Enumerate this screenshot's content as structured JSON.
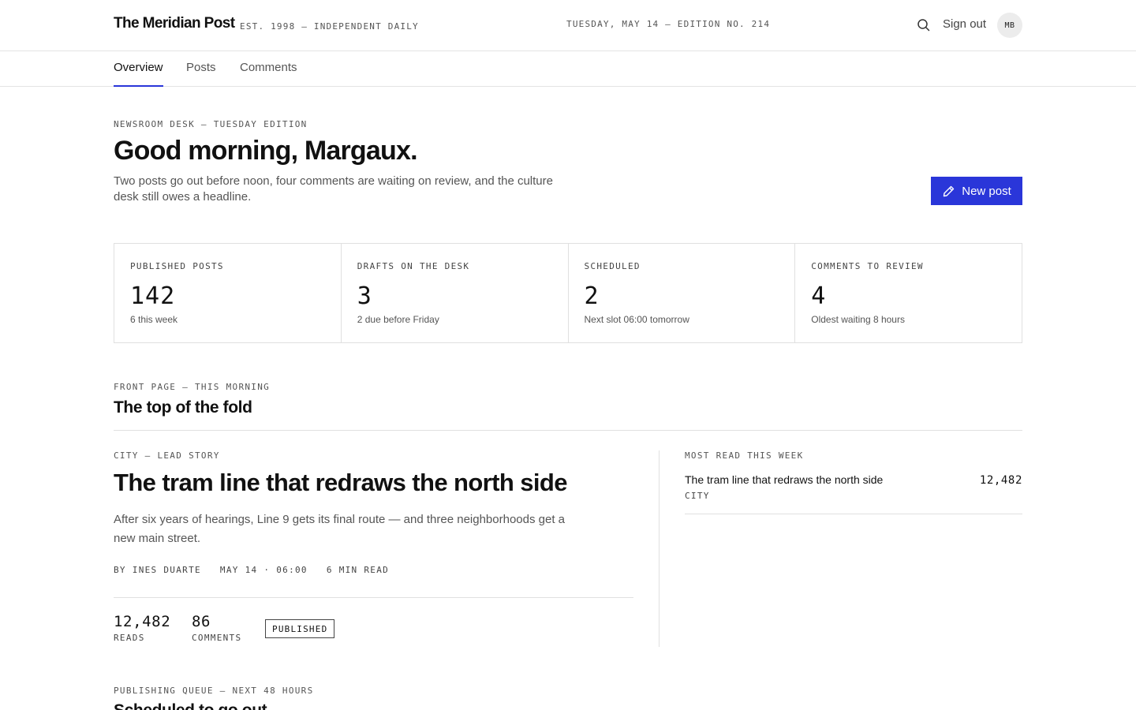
{
  "header": {
    "brand": "The Meridian Post",
    "tagline": "EST. 1998 — INDEPENDENT DAILY",
    "edition": "TUESDAY, MAY 14 — EDITION NO. 214",
    "search_icon": "search-icon",
    "sign_out": "Sign out",
    "avatar_initials": "MB"
  },
  "tabs": [
    {
      "label": "Overview",
      "active": true
    },
    {
      "label": "Posts",
      "active": false
    },
    {
      "label": "Comments",
      "active": false
    }
  ],
  "greeting": {
    "kicker": "NEWSROOM DESK — TUESDAY EDITION",
    "title": "Good morning, Margaux.",
    "subtitle": "Two posts go out before noon, four comments are waiting on review, and the culture desk still owes a headline.",
    "new_post_label": "New post",
    "new_post_icon": "pencil-icon"
  },
  "stats": [
    {
      "label": "PUBLISHED POSTS",
      "value": "142",
      "note": "6 this week"
    },
    {
      "label": "DRAFTS ON THE DESK",
      "value": "3",
      "note": "2 due before Friday"
    },
    {
      "label": "SCHEDULED",
      "value": "2",
      "note": "Next slot 06:00 tomorrow"
    },
    {
      "label": "COMMENTS TO REVIEW",
      "value": "4",
      "note": "Oldest waiting 8 hours"
    }
  ],
  "front_page": {
    "kicker": "FRONT PAGE — THIS MORNING",
    "title": "The top of the fold",
    "lead": {
      "kicker": "CITY — LEAD STORY",
      "title": "The tram line that redraws the north side",
      "summary": "After six years of hearings, Line 9 gets its final route — and three neighborhoods get a new main street.",
      "byline": "BY INES DUARTE",
      "date": "MAY 14 · 06:00",
      "read_time": "6 MIN READ",
      "reads_value": "12,482",
      "reads_label": "READS",
      "comments_value": "86",
      "comments_label": "COMMENTS",
      "status": "PUBLISHED"
    },
    "most_read": {
      "kicker": "MOST READ THIS WEEK",
      "items": [
        {
          "title": "The tram line that redraws the north side",
          "category": "CITY",
          "count": "12,482"
        }
      ]
    }
  },
  "queue": {
    "kicker": "PUBLISHING QUEUE — NEXT 48 HOURS",
    "title": "Scheduled to go out"
  },
  "colors": {
    "accent": "#2a36d9",
    "text": "#111111",
    "muted": "#555555",
    "border": "#e0e0e0"
  }
}
